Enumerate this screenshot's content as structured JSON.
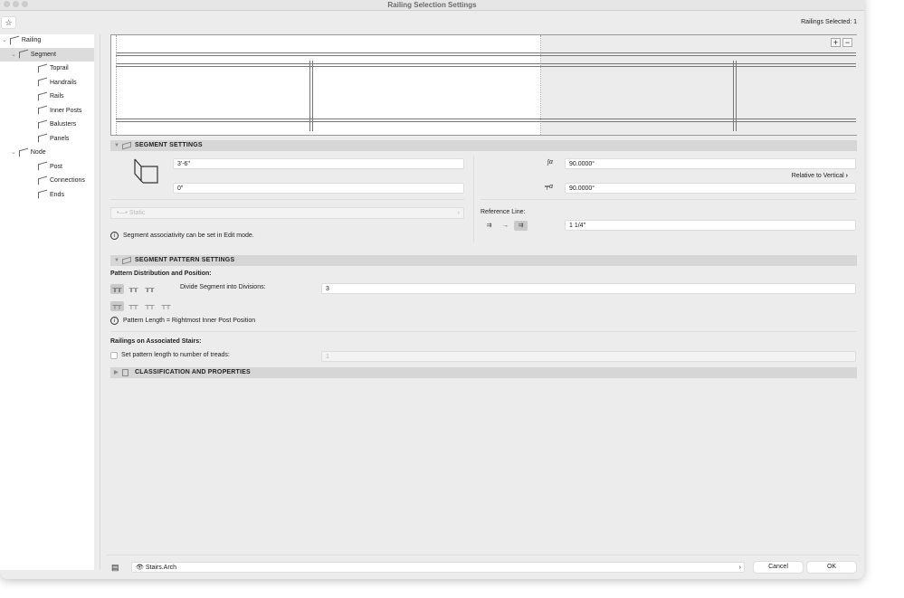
{
  "window": {
    "title": "Railing Selection Settings",
    "selected_count": "Railings Selected: 1"
  },
  "sidebar": {
    "items": [
      {
        "label": "Railing",
        "level": 0,
        "expanded": true
      },
      {
        "label": "Segment",
        "level": 1,
        "expanded": true,
        "selected": true
      },
      {
        "label": "Toprail",
        "level": 2
      },
      {
        "label": "Handrails",
        "level": 2
      },
      {
        "label": "Rails",
        "level": 2
      },
      {
        "label": "Inner Posts",
        "level": 2
      },
      {
        "label": "Balusters",
        "level": 2
      },
      {
        "label": "Panels",
        "level": 2
      },
      {
        "label": "Node",
        "level": 1,
        "expanded": true
      },
      {
        "label": "Post",
        "level": 2
      },
      {
        "label": "Connections",
        "level": 2
      },
      {
        "label": "Ends",
        "level": 2
      }
    ]
  },
  "preview": {
    "zoom_in": "+",
    "zoom_out": "−"
  },
  "segment_settings": {
    "title": "SEGMENT SETTINGS",
    "height": "3'-6\"",
    "offset": "0\"",
    "angle1": "90.0000°",
    "relative_label": "Relative to Vertical",
    "angle2": "90.0000°",
    "associativity": "Static",
    "info": "Segment associativity can be set in Edit mode.",
    "reference_line_label": "Reference Line:",
    "reference_offset": "1 1/4\""
  },
  "pattern_settings": {
    "title": "SEGMENT PATTERN SETTINGS",
    "distribution_label": "Pattern Distribution and Position:",
    "divide_label": "Divide Segment into Divisions:",
    "divisions": "3",
    "info": "Pattern Length = Rightmost Inner Post Position",
    "stairs_label": "Railings on Associated Stairs:",
    "treads_checkbox_label": "Set pattern length to number of treads:",
    "treads_checked": false,
    "treads_value": "1"
  },
  "classification": {
    "title": "CLASSIFICATION AND PROPERTIES"
  },
  "footer": {
    "layer": "Stairs.Arch",
    "cancel": "Cancel",
    "ok": "OK"
  }
}
